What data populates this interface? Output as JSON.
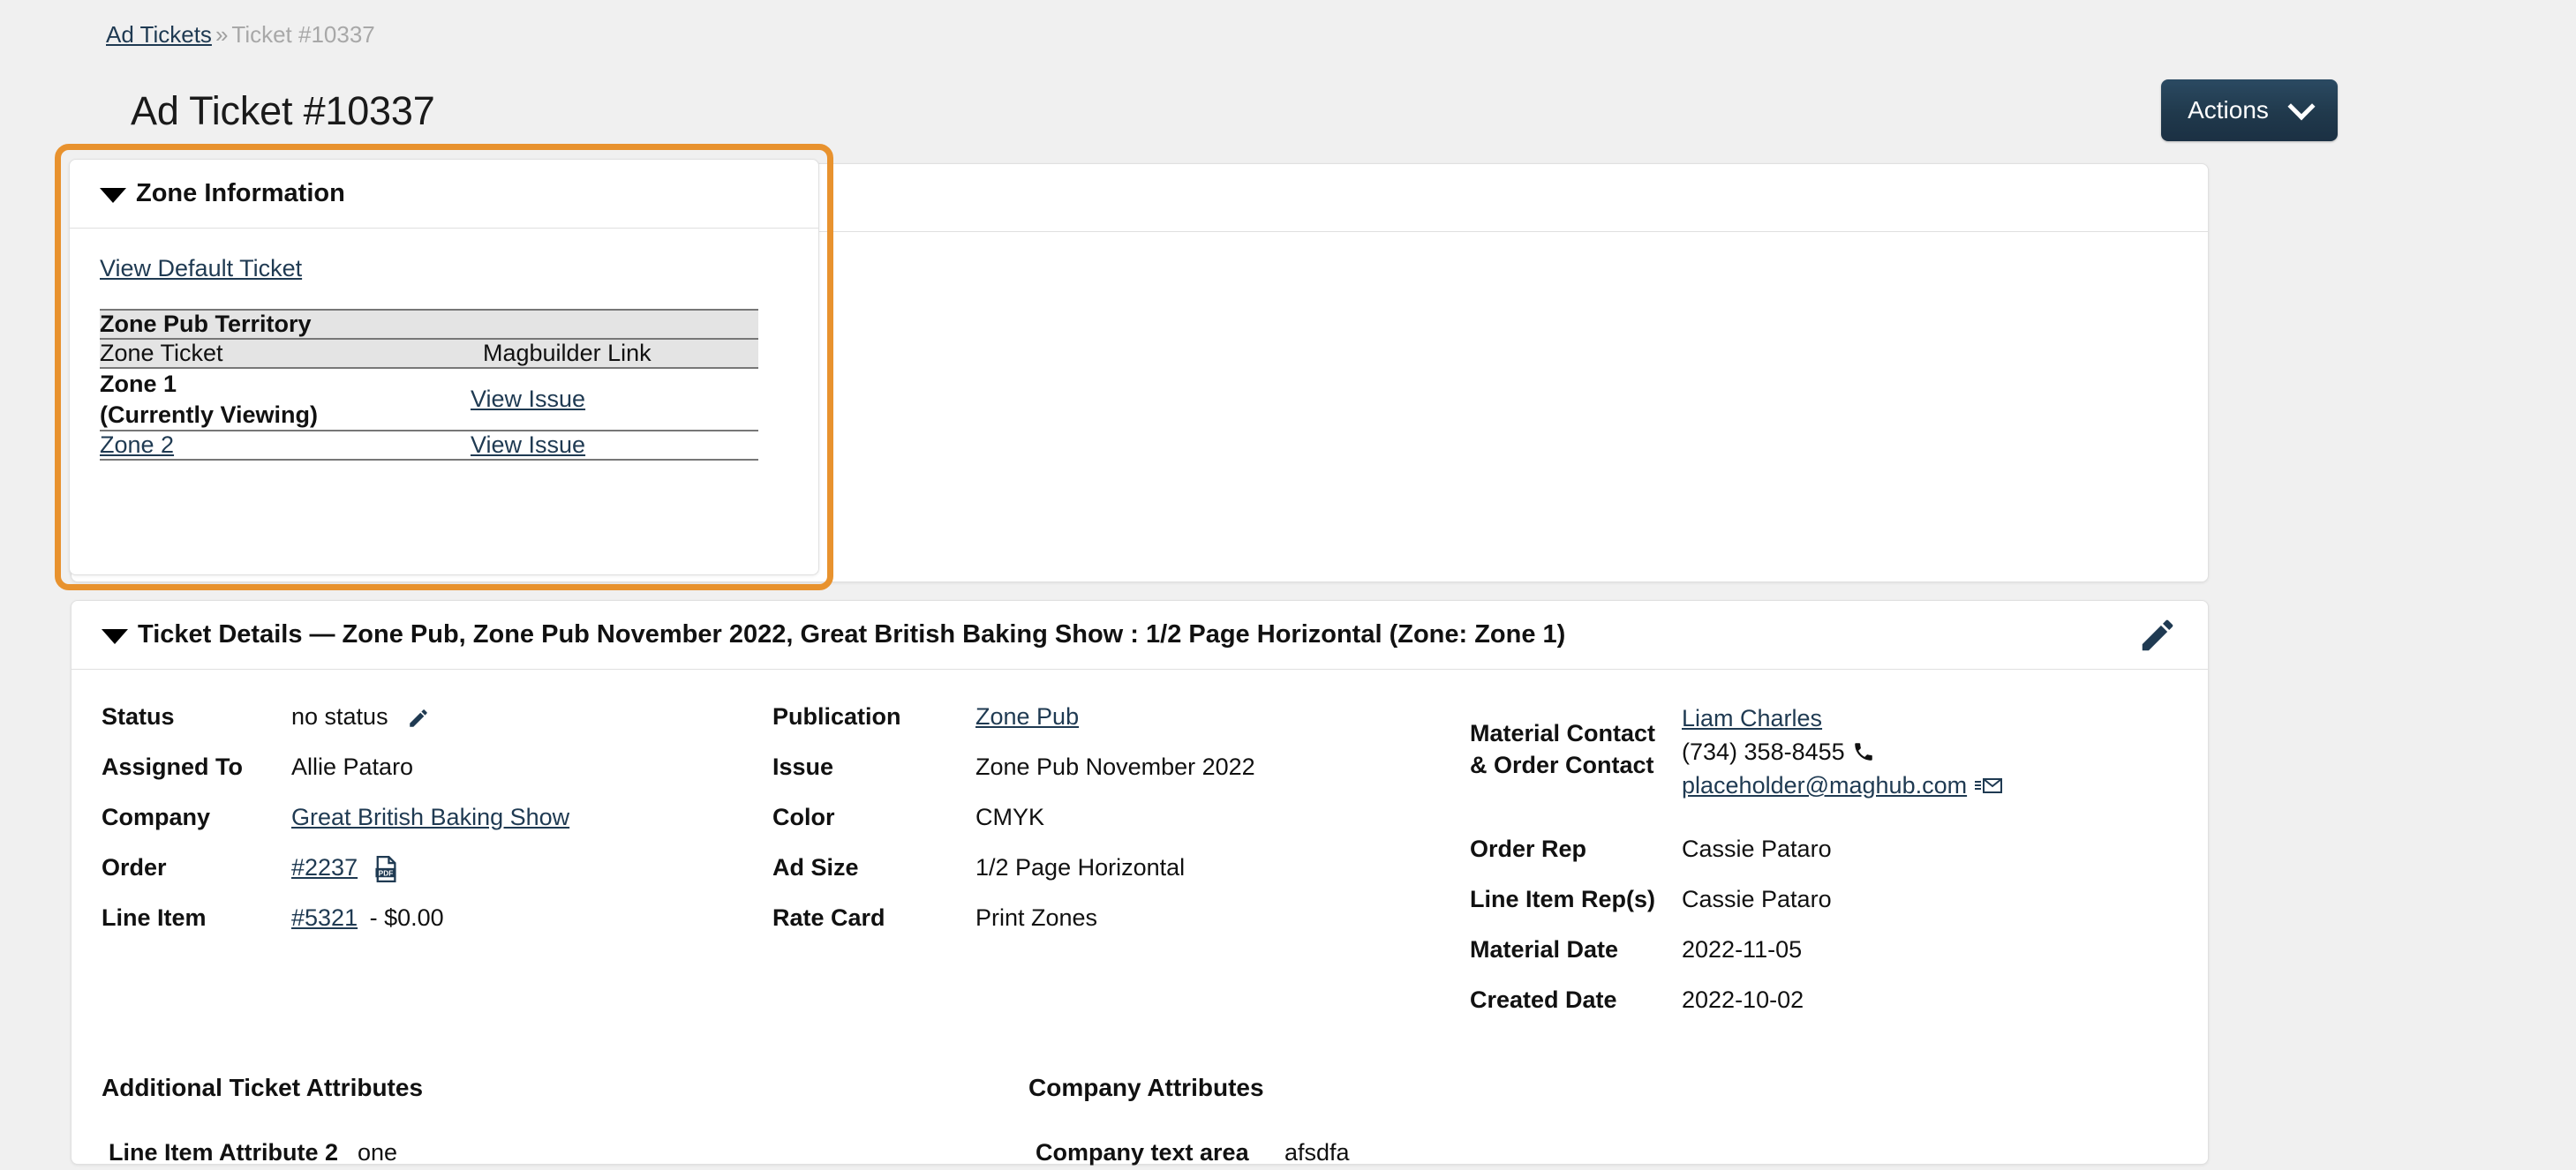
{
  "breadcrumb": {
    "root_label": "Ad Tickets",
    "separator": "»",
    "current_label": "Ticket #10337"
  },
  "page": {
    "title": "Ad Ticket #10337"
  },
  "toolbar": {
    "actions_label": "Actions",
    "actions_caret_icon": "chevron-down-icon"
  },
  "zone_panel": {
    "title": "Zone Information",
    "collapse_icon": "caret-down-icon",
    "view_default_ticket_label": "View Default Ticket",
    "table": {
      "group_title": "Zone Pub Territory",
      "columns": [
        "Zone Ticket",
        "Magbuilder Link"
      ],
      "rows": [
        {
          "zone_name": "Zone 1",
          "zone_note": "(Currently Viewing)",
          "is_current": true,
          "link_label": "View Issue"
        },
        {
          "zone_name": "Zone 2",
          "zone_note": "",
          "is_current": false,
          "link_label": "View Issue"
        }
      ]
    }
  },
  "details_panel": {
    "title": "Ticket Details — Zone Pub, Zone Pub November 2022, Great British Baking Show : 1/2 Page Horizontal (Zone: Zone 1)",
    "collapse_icon": "caret-down-icon",
    "edit_icon": "pencil-icon",
    "column_1": {
      "status_label": "Status",
      "status_value": "no status",
      "status_edit_icon": "pencil-icon",
      "assigned_to_label": "Assigned To",
      "assigned_to_value": "Allie Pataro",
      "company_label": "Company",
      "company_value": "Great British Baking Show",
      "order_label": "Order",
      "order_value": "#2237",
      "order_pdf_icon": "pdf-file-icon",
      "line_item_label": "Line Item",
      "line_item_value": "#5321",
      "line_item_amount": "- $0.00"
    },
    "column_2": {
      "publication_label": "Publication",
      "publication_value": "Zone Pub",
      "issue_label": "Issue",
      "issue_value": "Zone Pub November 2022",
      "color_label": "Color",
      "color_value": "CMYK",
      "ad_size_label": "Ad Size",
      "ad_size_value": "1/2 Page Horizontal",
      "rate_card_label": "Rate Card",
      "rate_card_value": "Print Zones"
    },
    "column_3": {
      "contact_label_line1": "Material Contact",
      "contact_label_line2": "& Order Contact",
      "contact_name": "Liam Charles",
      "contact_phone": "(734) 358-8455",
      "phone_icon": "phone-icon",
      "contact_email": "placeholder@maghub.com",
      "email_icon": "envelope-icon",
      "order_rep_label": "Order Rep",
      "order_rep_value": "Cassie Pataro",
      "line_item_reps_label": "Line Item Rep(s)",
      "line_item_reps_value": "Cassie Pataro",
      "material_date_label": "Material Date",
      "material_date_value": "2022-11-05",
      "created_date_label": "Created Date",
      "created_date_value": "2022-10-02"
    },
    "additional_ticket_attributes": {
      "heading": "Additional Ticket Attributes",
      "rows": [
        {
          "name": "Line Item Attribute 2",
          "value": "one"
        }
      ]
    },
    "company_attributes": {
      "heading": "Company Attributes",
      "rows": [
        {
          "name": "Company text area",
          "value": "afsdfa"
        }
      ]
    }
  },
  "colors": {
    "page_background": "#f0f0f0",
    "card_background": "#ffffff",
    "highlight_ring": "#e8922e",
    "link": "#1f3a52",
    "actions_button": "#20394c",
    "table_header_background": "#e4e4e4",
    "muted_text": "#a8a8a8"
  }
}
